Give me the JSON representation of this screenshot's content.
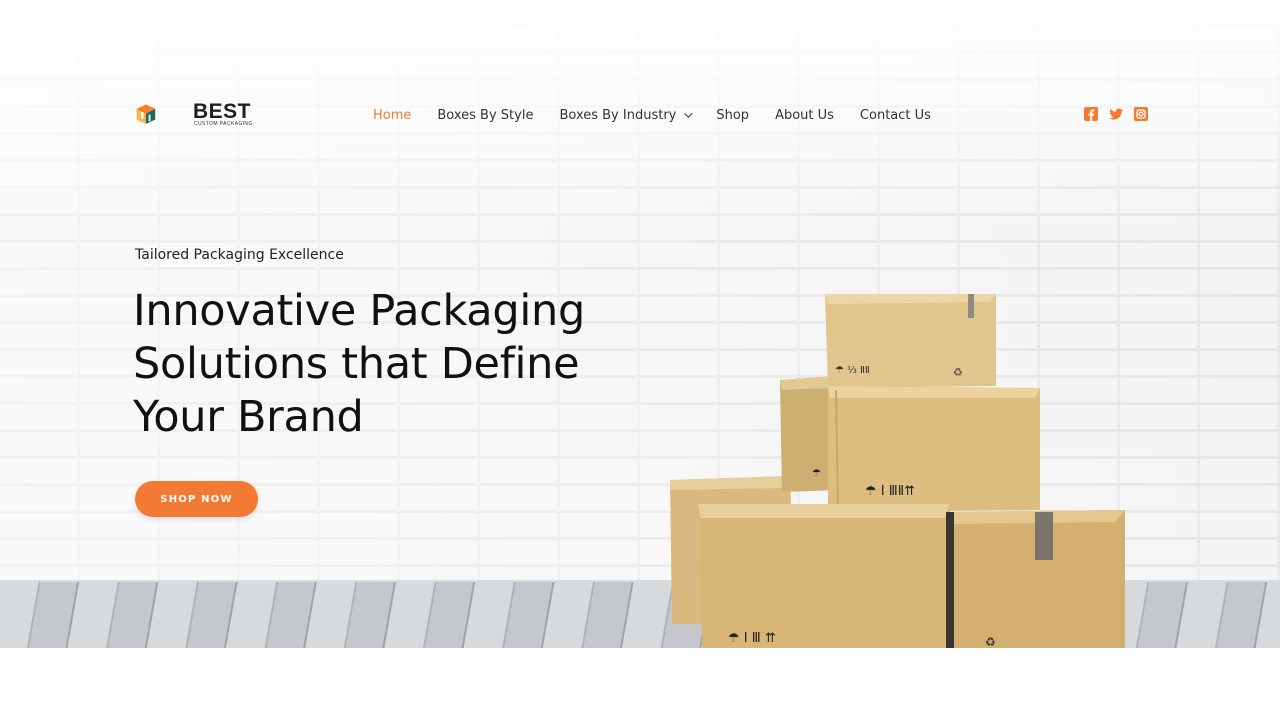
{
  "brand": {
    "name": "BEST",
    "subtitle": "CUSTOM PACKAGING"
  },
  "nav": {
    "items": [
      {
        "label": "Home",
        "active": true
      },
      {
        "label": "Boxes By Style",
        "active": false
      },
      {
        "label": "Boxes By Industry",
        "active": false,
        "has_dropdown": true
      },
      {
        "label": "Shop",
        "active": false
      },
      {
        "label": "About Us",
        "active": false
      },
      {
        "label": "Contact Us",
        "active": false
      }
    ]
  },
  "social": {
    "icons": [
      "facebook-icon",
      "twitter-icon",
      "instagram-icon"
    ]
  },
  "hero": {
    "tagline": "Tailored Packaging Excellence",
    "headline_lines": [
      "Innovative Packaging",
      "Solutions that Define",
      "Your Brand"
    ],
    "cta_label": "SHOP NOW"
  },
  "colors": {
    "accent": "#f27a33",
    "text_dark": "#111111",
    "nav_text": "#333333",
    "logo_orange": "#f39a2d",
    "logo_teal": "#1a6b66"
  }
}
